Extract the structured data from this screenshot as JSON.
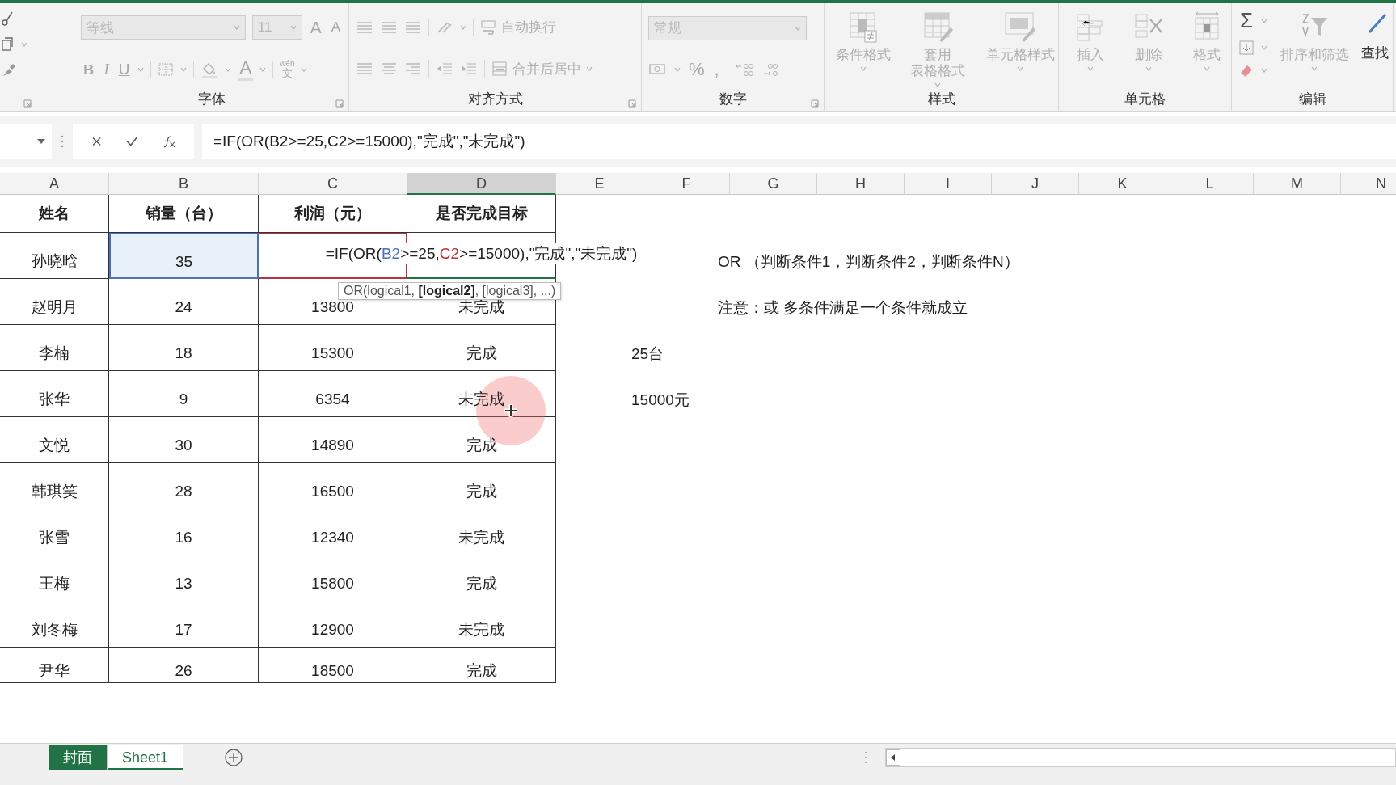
{
  "ribbon": {
    "font": {
      "label": "字体",
      "font_name": "等线",
      "font_size": "11",
      "grow": "A",
      "shrink": "A",
      "bold": "B",
      "italic": "I",
      "underline": "U",
      "font_color": "A",
      "phonetic_top": "wén",
      "phonetic_bottom": "文"
    },
    "alignment": {
      "label": "对齐方式",
      "wrap_text": "自动换行",
      "merge_center": "合并后居中"
    },
    "number": {
      "label": "数字",
      "format": "常规",
      "percent": "%",
      "comma": ","
    },
    "styles": {
      "label": "样式",
      "conditional": "条件格式",
      "table_format_top": "套用",
      "table_format_bottom": "表格格式",
      "cell_styles": "单元格样式"
    },
    "cells": {
      "label": "单元格",
      "insert": "插入",
      "delete": "删除",
      "format": "格式"
    },
    "editing": {
      "label": "编辑",
      "sum": "Σ",
      "sort_filter": "排序和筛选",
      "find": "查找"
    }
  },
  "formula_bar": {
    "formula": "=IF(OR(B2>=25,C2>=15000),\"完成\",\"未完成\")"
  },
  "columns": [
    {
      "label": "A",
      "selected": false
    },
    {
      "label": "B",
      "selected": false
    },
    {
      "label": "C",
      "selected": false
    },
    {
      "label": "D",
      "selected": true
    },
    {
      "label": "E",
      "selected": false
    },
    {
      "label": "F",
      "selected": false
    },
    {
      "label": "G",
      "selected": false
    },
    {
      "label": "H",
      "selected": false
    },
    {
      "label": "I",
      "selected": false
    },
    {
      "label": "J",
      "selected": false
    },
    {
      "label": "K",
      "selected": false
    },
    {
      "label": "L",
      "selected": false
    },
    {
      "label": "M",
      "selected": false
    },
    {
      "label": "N",
      "selected": false
    }
  ],
  "table": {
    "header": [
      "姓名",
      "销量（台）",
      "利润（元）",
      "是否完成目标"
    ],
    "rows": [
      {
        "kind": "editing",
        "cells": [
          "孙晓晗",
          "35"
        ],
        "formula_parts": [
          {
            "text": "=IF(OR("
          },
          {
            "text": "B2",
            "color": "#4a72b8"
          },
          {
            "text": ">=25,"
          },
          {
            "text": "C2",
            "color": "#b8323f"
          },
          {
            "text": ">=15000),\"完成\",\"未完成\")"
          }
        ],
        "tooltip": "OR(logical1, **[logical2]**, [logical3], ...)",
        "notes": [
          {
            "kind": "wide",
            "text": "OR （判断条件1，判断条件2，判断条件N）"
          }
        ]
      },
      {
        "kind": "data",
        "cells": [
          "赵明月",
          "24",
          "13800",
          "未完成"
        ],
        "notes": [
          {
            "kind": "wide",
            "text": "注意：或  多条件满足一个条件就成立"
          }
        ]
      },
      {
        "kind": "data",
        "cells": [
          "李楠",
          "18",
          "15300",
          "完成"
        ],
        "notes": [
          {
            "kind": "value",
            "text": "25台"
          }
        ]
      },
      {
        "kind": "data",
        "cells": [
          "张华",
          "9",
          "6354",
          "未完成"
        ],
        "notes": [
          {
            "kind": "value",
            "text": "15000元"
          }
        ]
      },
      {
        "kind": "data",
        "cells": [
          "文悦",
          "30",
          "14890",
          "完成"
        ]
      },
      {
        "kind": "data",
        "cells": [
          "韩琪笑",
          "28",
          "16500",
          "完成"
        ]
      },
      {
        "kind": "data",
        "cells": [
          "张雪",
          "16",
          "12340",
          "未完成"
        ]
      },
      {
        "kind": "data",
        "cells": [
          "王梅",
          "13",
          "15800",
          "完成"
        ]
      },
      {
        "kind": "data",
        "cells": [
          "刘冬梅",
          "17",
          "12900",
          "未完成"
        ]
      },
      {
        "kind": "data",
        "cells": [
          "尹华",
          "26",
          "18500",
          "完成"
        ]
      }
    ]
  },
  "sheet_tabs": [
    {
      "label": "封面",
      "selected": false,
      "color": "#217346"
    },
    {
      "label": "Sheet1",
      "selected": true
    }
  ]
}
